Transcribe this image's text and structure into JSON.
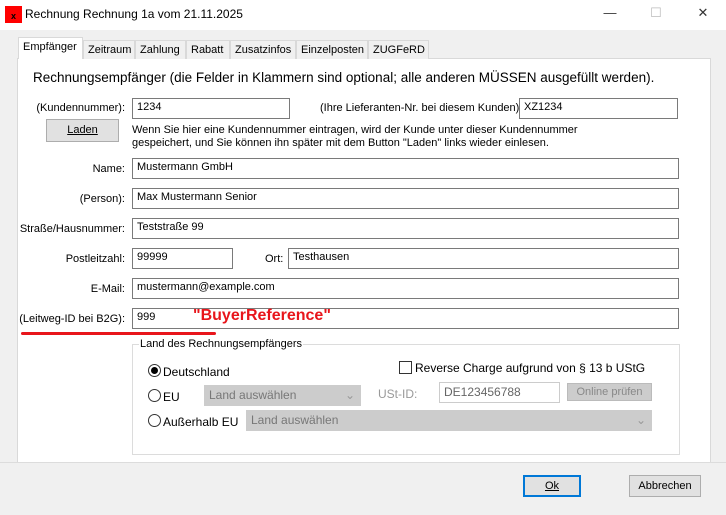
{
  "window": {
    "title": "Rechnung Rechnung 1a vom 21.11.2025",
    "icon_text": "x"
  },
  "tabs": [
    "Empfänger",
    "Zeitraum",
    "Zahlung",
    "Rabatt",
    "Zusatzinfos",
    "Einzelposten",
    "ZUGFeRD"
  ],
  "heading": "Rechnungsempfänger (die Felder in Klammern sind optional; alle anderen MÜSSEN ausgefüllt werden).",
  "fields": {
    "kundennummer": {
      "label": "(Kundennummer):",
      "value": "1234"
    },
    "lieferant": {
      "label": "(Ihre Lieferanten-Nr. bei diesem Kunden):",
      "value": "XZ1234"
    },
    "name": {
      "label": "Name:",
      "value": "Mustermann GmbH"
    },
    "person": {
      "label": "(Person):",
      "value": "Max Mustermann Senior"
    },
    "strasse": {
      "label": "Straße/Hausnummer:",
      "value": "Teststraße 99"
    },
    "plz": {
      "label": "Postleitzahl:",
      "value": "99999"
    },
    "ort": {
      "label": "Ort:",
      "value": "Testhausen"
    },
    "email": {
      "label": "E-Mail:",
      "value": "mustermann@example.com"
    },
    "leitweg": {
      "label": "(Leitweg-ID bei B2G):",
      "value": "999"
    }
  },
  "laden_button": "Laden",
  "help_text": [
    "Wenn Sie hier eine Kundennummer eintragen, wird der Kunde unter dieser Kundennummer",
    "gespeichert, und Sie können ihn später mit dem Button \"Laden\" links wieder einlesen."
  ],
  "annotation": {
    "text": "\"BuyerReference\"",
    "color": "#e8151b"
  },
  "country_group": {
    "title": "Land des Rechnungsempfängers",
    "radios": [
      {
        "label": "Deutschland",
        "checked": true
      },
      {
        "label": "EU",
        "checked": false
      },
      {
        "label": "Außerhalb EU",
        "checked": false
      }
    ],
    "eu_select": "Land auswählen",
    "non_eu_select": "Land auswählen",
    "reverse_charge": {
      "label": "Reverse Charge aufgrund von § 13 b UStG",
      "checked": false
    },
    "ustid_label": "USt-ID:",
    "ustid_value": "DE123456788",
    "online_check": "Online prüfen"
  },
  "buttons": {
    "ok": "Ok",
    "cancel": "Abbrechen"
  }
}
